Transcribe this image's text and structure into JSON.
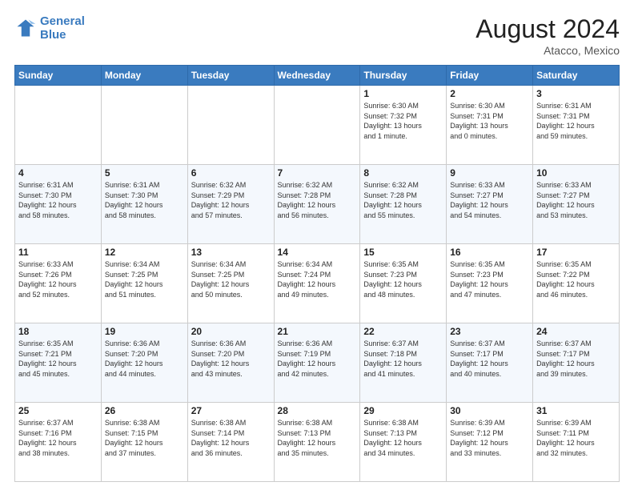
{
  "header": {
    "logo_line1": "General",
    "logo_line2": "Blue",
    "month_year": "August 2024",
    "location": "Atacco, Mexico"
  },
  "weekdays": [
    "Sunday",
    "Monday",
    "Tuesday",
    "Wednesday",
    "Thursday",
    "Friday",
    "Saturday"
  ],
  "weeks": [
    [
      {
        "day": "",
        "info": ""
      },
      {
        "day": "",
        "info": ""
      },
      {
        "day": "",
        "info": ""
      },
      {
        "day": "",
        "info": ""
      },
      {
        "day": "1",
        "info": "Sunrise: 6:30 AM\nSunset: 7:32 PM\nDaylight: 13 hours\nand 1 minute."
      },
      {
        "day": "2",
        "info": "Sunrise: 6:30 AM\nSunset: 7:31 PM\nDaylight: 13 hours\nand 0 minutes."
      },
      {
        "day": "3",
        "info": "Sunrise: 6:31 AM\nSunset: 7:31 PM\nDaylight: 12 hours\nand 59 minutes."
      }
    ],
    [
      {
        "day": "4",
        "info": "Sunrise: 6:31 AM\nSunset: 7:30 PM\nDaylight: 12 hours\nand 58 minutes."
      },
      {
        "day": "5",
        "info": "Sunrise: 6:31 AM\nSunset: 7:30 PM\nDaylight: 12 hours\nand 58 minutes."
      },
      {
        "day": "6",
        "info": "Sunrise: 6:32 AM\nSunset: 7:29 PM\nDaylight: 12 hours\nand 57 minutes."
      },
      {
        "day": "7",
        "info": "Sunrise: 6:32 AM\nSunset: 7:28 PM\nDaylight: 12 hours\nand 56 minutes."
      },
      {
        "day": "8",
        "info": "Sunrise: 6:32 AM\nSunset: 7:28 PM\nDaylight: 12 hours\nand 55 minutes."
      },
      {
        "day": "9",
        "info": "Sunrise: 6:33 AM\nSunset: 7:27 PM\nDaylight: 12 hours\nand 54 minutes."
      },
      {
        "day": "10",
        "info": "Sunrise: 6:33 AM\nSunset: 7:27 PM\nDaylight: 12 hours\nand 53 minutes."
      }
    ],
    [
      {
        "day": "11",
        "info": "Sunrise: 6:33 AM\nSunset: 7:26 PM\nDaylight: 12 hours\nand 52 minutes."
      },
      {
        "day": "12",
        "info": "Sunrise: 6:34 AM\nSunset: 7:25 PM\nDaylight: 12 hours\nand 51 minutes."
      },
      {
        "day": "13",
        "info": "Sunrise: 6:34 AM\nSunset: 7:25 PM\nDaylight: 12 hours\nand 50 minutes."
      },
      {
        "day": "14",
        "info": "Sunrise: 6:34 AM\nSunset: 7:24 PM\nDaylight: 12 hours\nand 49 minutes."
      },
      {
        "day": "15",
        "info": "Sunrise: 6:35 AM\nSunset: 7:23 PM\nDaylight: 12 hours\nand 48 minutes."
      },
      {
        "day": "16",
        "info": "Sunrise: 6:35 AM\nSunset: 7:23 PM\nDaylight: 12 hours\nand 47 minutes."
      },
      {
        "day": "17",
        "info": "Sunrise: 6:35 AM\nSunset: 7:22 PM\nDaylight: 12 hours\nand 46 minutes."
      }
    ],
    [
      {
        "day": "18",
        "info": "Sunrise: 6:35 AM\nSunset: 7:21 PM\nDaylight: 12 hours\nand 45 minutes."
      },
      {
        "day": "19",
        "info": "Sunrise: 6:36 AM\nSunset: 7:20 PM\nDaylight: 12 hours\nand 44 minutes."
      },
      {
        "day": "20",
        "info": "Sunrise: 6:36 AM\nSunset: 7:20 PM\nDaylight: 12 hours\nand 43 minutes."
      },
      {
        "day": "21",
        "info": "Sunrise: 6:36 AM\nSunset: 7:19 PM\nDaylight: 12 hours\nand 42 minutes."
      },
      {
        "day": "22",
        "info": "Sunrise: 6:37 AM\nSunset: 7:18 PM\nDaylight: 12 hours\nand 41 minutes."
      },
      {
        "day": "23",
        "info": "Sunrise: 6:37 AM\nSunset: 7:17 PM\nDaylight: 12 hours\nand 40 minutes."
      },
      {
        "day": "24",
        "info": "Sunrise: 6:37 AM\nSunset: 7:17 PM\nDaylight: 12 hours\nand 39 minutes."
      }
    ],
    [
      {
        "day": "25",
        "info": "Sunrise: 6:37 AM\nSunset: 7:16 PM\nDaylight: 12 hours\nand 38 minutes."
      },
      {
        "day": "26",
        "info": "Sunrise: 6:38 AM\nSunset: 7:15 PM\nDaylight: 12 hours\nand 37 minutes."
      },
      {
        "day": "27",
        "info": "Sunrise: 6:38 AM\nSunset: 7:14 PM\nDaylight: 12 hours\nand 36 minutes."
      },
      {
        "day": "28",
        "info": "Sunrise: 6:38 AM\nSunset: 7:13 PM\nDaylight: 12 hours\nand 35 minutes."
      },
      {
        "day": "29",
        "info": "Sunrise: 6:38 AM\nSunset: 7:13 PM\nDaylight: 12 hours\nand 34 minutes."
      },
      {
        "day": "30",
        "info": "Sunrise: 6:39 AM\nSunset: 7:12 PM\nDaylight: 12 hours\nand 33 minutes."
      },
      {
        "day": "31",
        "info": "Sunrise: 6:39 AM\nSunset: 7:11 PM\nDaylight: 12 hours\nand 32 minutes."
      }
    ]
  ]
}
